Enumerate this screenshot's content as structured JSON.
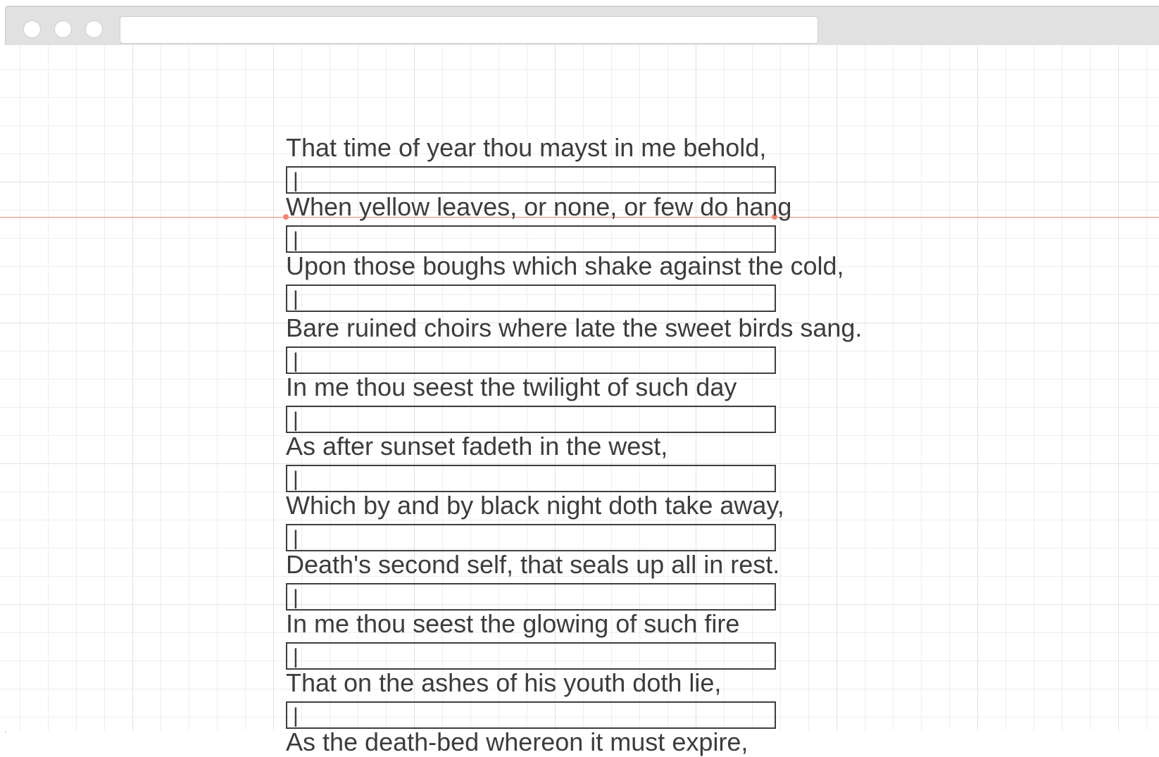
{
  "browser": {
    "address_value": ""
  },
  "editor": {
    "caret": "|",
    "lines": [
      "That time of year thou mayst in me behold,",
      "When yellow leaves, or none, or few do hang",
      "Upon those boughs which shake against the cold,",
      "Bare ruined choirs where late the sweet birds sang.",
      "In me thou seest the twilight of such day",
      "As after sunset fadeth in the west,",
      "Which by and by black night doth take away,",
      "Death's second self, that seals up all in rest.",
      "In me thou seest the glowing of such fire",
      "That on the ashes of his youth doth lie,",
      "As the death-bed whereon it must expire,"
    ]
  },
  "colors": {
    "guide": "#f08a78",
    "text": "#3c3c3c",
    "grid": "#e2e2e2"
  }
}
